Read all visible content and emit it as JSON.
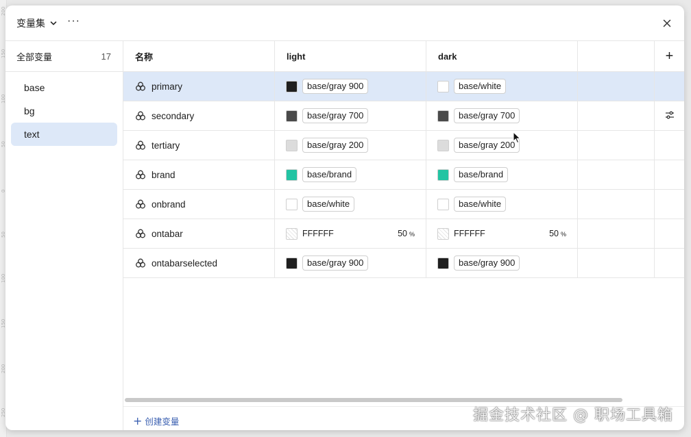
{
  "ruler": [
    "200",
    "150",
    "100",
    "50",
    "0",
    "50",
    "100",
    "150",
    "200",
    "250"
  ],
  "header": {
    "title": "变量集",
    "more": "···"
  },
  "sidebar": {
    "all_label": "全部变量",
    "count": "17",
    "items": [
      {
        "label": "base"
      },
      {
        "label": "bg"
      },
      {
        "label": "text"
      }
    ]
  },
  "table": {
    "columns": {
      "name": "名称",
      "light": "light",
      "dark": "dark",
      "add": "+"
    },
    "rows": [
      {
        "name": "primary",
        "light": {
          "color": "#1f1f1f",
          "value": "base/gray 900"
        },
        "dark": {
          "color": "#ffffff",
          "value": "base/white"
        }
      },
      {
        "name": "secondary",
        "light": {
          "color": "#4a4a4a",
          "value": "base/gray 700"
        },
        "dark": {
          "color": "#4a4a4a",
          "value": "base/gray 700"
        }
      },
      {
        "name": "tertiary",
        "light": {
          "color": "#dcdcdc",
          "value": "base/gray 200"
        },
        "dark": {
          "color": "#dcdcdc",
          "value": "base/gray 200"
        }
      },
      {
        "name": "brand",
        "light": {
          "color": "#22c4a3",
          "value": "base/brand"
        },
        "dark": {
          "color": "#22c4a3",
          "value": "base/brand"
        }
      },
      {
        "name": "onbrand",
        "light": {
          "color": "#ffffff",
          "value": "base/white"
        },
        "dark": {
          "color": "#ffffff",
          "value": "base/white"
        }
      },
      {
        "name": "ontabar",
        "light": {
          "hex": "FFFFFF",
          "opacity": "50",
          "unit": "%"
        },
        "dark": {
          "hex": "FFFFFF",
          "opacity": "50",
          "unit": "%"
        }
      },
      {
        "name": "ontabarselected",
        "light": {
          "color": "#1f1f1f",
          "value": "base/gray 900"
        },
        "dark": {
          "color": "#1f1f1f",
          "value": "base/gray 900"
        }
      }
    ]
  },
  "footer": {
    "create_label": "创建变量",
    "create_icon": "+"
  },
  "watermark": "掘金技术社区 @ 职场工具箱",
  "colors": {
    "selected_bg": "#dde8f8",
    "link": "#3a5fb0",
    "border": "#e6e6e6"
  }
}
